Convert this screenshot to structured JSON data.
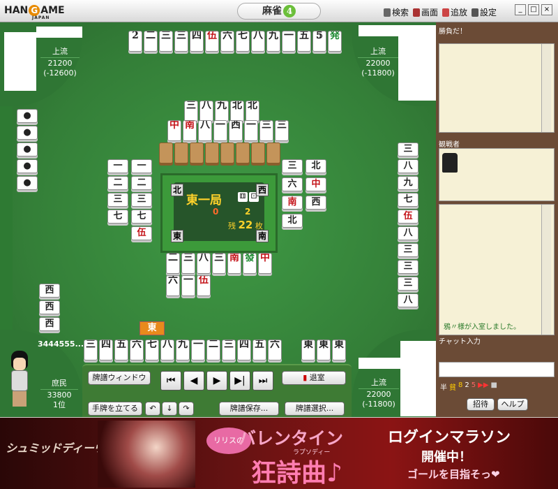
{
  "titlebar": {
    "logo": "HANGAME",
    "logo_sub": "JAPAN",
    "game_title": "麻雀",
    "menu": [
      {
        "label": "検索",
        "icon": "binoculars-icon"
      },
      {
        "label": "画面",
        "icon": "screen-icon"
      },
      {
        "label": "追放",
        "icon": "kick-icon"
      },
      {
        "label": "設定",
        "icon": "settings-icon"
      }
    ],
    "window_buttons": [
      "_",
      "□",
      "×"
    ]
  },
  "players": {
    "top_left": {
      "rank": "上流",
      "points": "21200",
      "diff": "(-12600)"
    },
    "top_right": {
      "rank": "上流",
      "points": "22000",
      "diff": "(-11800)"
    },
    "bottom_right": {
      "rank": "上流",
      "points": "22000",
      "diff": "(-11800)"
    },
    "self": {
      "id": "3444555...",
      "rank": "庶民",
      "points": "33800",
      "place": "1位"
    }
  },
  "center": {
    "round": "東一局",
    "honba": "0",
    "riichi": "2",
    "remain_label": "残",
    "remain": "22",
    "remain_unit": "枚",
    "winds": {
      "north": "北",
      "west": "西",
      "east": "東",
      "south": "南"
    }
  },
  "dealer_marker": "東",
  "controls": {
    "record_window": "牌譜ウィンドウ",
    "exit": "退室",
    "stand_hand": "手牌を立てる",
    "save": "牌譜保存...",
    "select": "牌譜選択..."
  },
  "right_panel": {
    "top_text": "勝負だ！",
    "spectators_label": "観戦者",
    "chat_message": "鴉〃様が入室しました。",
    "chat_input_label": "チャット入力",
    "invite": "招待",
    "help": "ヘルプ",
    "status_icons": [
      "半",
      "貧",
      "8",
      "2",
      "5",
      "▶▶",
      "■"
    ]
  },
  "banner": {
    "brand": "シュミッドディーヴァ",
    "badge": "リリスの",
    "valentine": "バレンタイン",
    "song": "狂詩曲♪",
    "song_ruby": "ラプソディー",
    "login": "ログインマラソン",
    "now": "開催中！",
    "goal": "ゴールを目指そっ❤"
  },
  "tiles": {
    "top_hand": [
      "𝟐",
      "二",
      "三",
      "三",
      "四",
      "伍",
      "六",
      "七",
      "八",
      "九",
      "一",
      "五",
      "𝟝",
      "発"
    ],
    "opposite_discards": [
      "三",
      "八",
      "九",
      "北",
      "北",
      "中",
      "南",
      "八",
      "一",
      "西",
      "一",
      "三",
      "三"
    ],
    "self_discards": [
      "二",
      "三",
      "八",
      "三",
      "南",
      "發",
      "中",
      "六",
      "一",
      "伍"
    ],
    "self_hand": [
      "三",
      "四",
      "五",
      "六",
      "七",
      "八",
      "九",
      "一",
      "二",
      "三",
      "四",
      "五",
      "六"
    ],
    "self_melds": [
      "東",
      "東",
      "東"
    ],
    "left_discards": [
      "一",
      "二",
      "三",
      "七",
      "伍"
    ],
    "right_discards": [
      "三",
      "北",
      "六",
      "中",
      "南",
      "西",
      "北"
    ],
    "bottom_left_melds": [
      "西",
      "西",
      "西"
    ],
    "right_hand": [
      "三",
      "八",
      "九",
      "七",
      "伍",
      "八",
      "三",
      "三"
    ]
  }
}
